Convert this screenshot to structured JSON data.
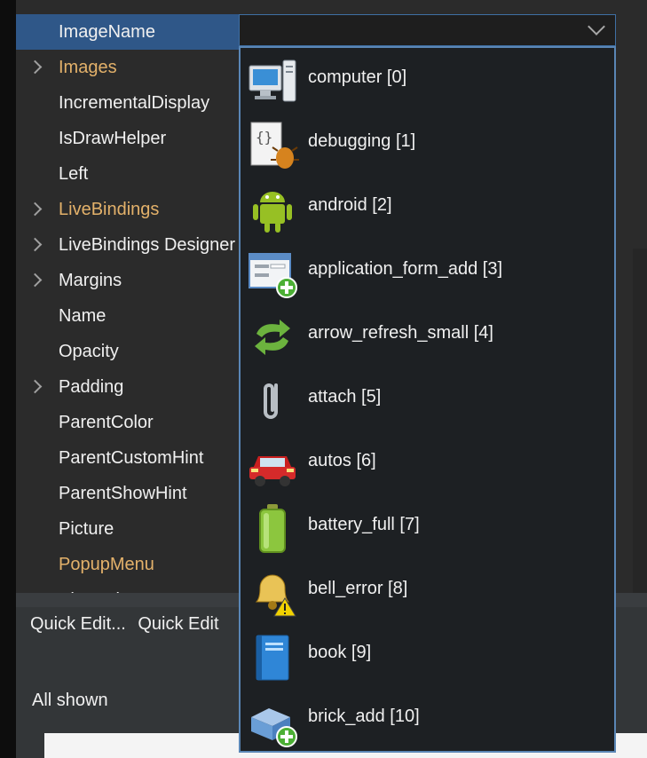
{
  "properties": [
    {
      "label": "ImageName",
      "selected": true,
      "expandable": false,
      "event": false
    },
    {
      "label": "Images",
      "selected": false,
      "expandable": true,
      "event": true
    },
    {
      "label": "IncrementalDisplay",
      "selected": false,
      "expandable": false,
      "event": false
    },
    {
      "label": "IsDrawHelper",
      "selected": false,
      "expandable": false,
      "event": false
    },
    {
      "label": "Left",
      "selected": false,
      "expandable": false,
      "event": false
    },
    {
      "label": "LiveBindings",
      "selected": false,
      "expandable": true,
      "event": true
    },
    {
      "label": "LiveBindings Designer",
      "selected": false,
      "expandable": true,
      "event": false
    },
    {
      "label": "Margins",
      "selected": false,
      "expandable": true,
      "event": false
    },
    {
      "label": "Name",
      "selected": false,
      "expandable": false,
      "event": false
    },
    {
      "label": "Opacity",
      "selected": false,
      "expandable": false,
      "event": false
    },
    {
      "label": "Padding",
      "selected": false,
      "expandable": true,
      "event": false
    },
    {
      "label": "ParentColor",
      "selected": false,
      "expandable": false,
      "event": false
    },
    {
      "label": "ParentCustomHint",
      "selected": false,
      "expandable": false,
      "event": false
    },
    {
      "label": "ParentShowHint",
      "selected": false,
      "expandable": false,
      "event": false
    },
    {
      "label": "Picture",
      "selected": false,
      "expandable": false,
      "event": false
    },
    {
      "label": "PopupMenu",
      "selected": false,
      "expandable": false,
      "event": true
    },
    {
      "label": "ShowHint",
      "selected": false,
      "expandable": false,
      "event": false
    }
  ],
  "quick_edit": {
    "link1": "Quick Edit...",
    "link2": "Quick Edit"
  },
  "status": "All shown",
  "dropdown_items": [
    {
      "label": "computer [0]",
      "icon": "computer-icon"
    },
    {
      "label": "debugging [1]",
      "icon": "debugging-icon"
    },
    {
      "label": "android [2]",
      "icon": "android-icon"
    },
    {
      "label": "application_form_add [3]",
      "icon": "application-form-add-icon"
    },
    {
      "label": "arrow_refresh_small [4]",
      "icon": "arrow-refresh-small-icon"
    },
    {
      "label": "attach [5]",
      "icon": "attach-icon"
    },
    {
      "label": "autos [6]",
      "icon": "autos-icon"
    },
    {
      "label": "battery_full [7]",
      "icon": "battery-full-icon"
    },
    {
      "label": "bell_error [8]",
      "icon": "bell-error-icon"
    },
    {
      "label": "book [9]",
      "icon": "book-icon"
    },
    {
      "label": "brick_add [10]",
      "icon": "brick-add-icon"
    }
  ]
}
